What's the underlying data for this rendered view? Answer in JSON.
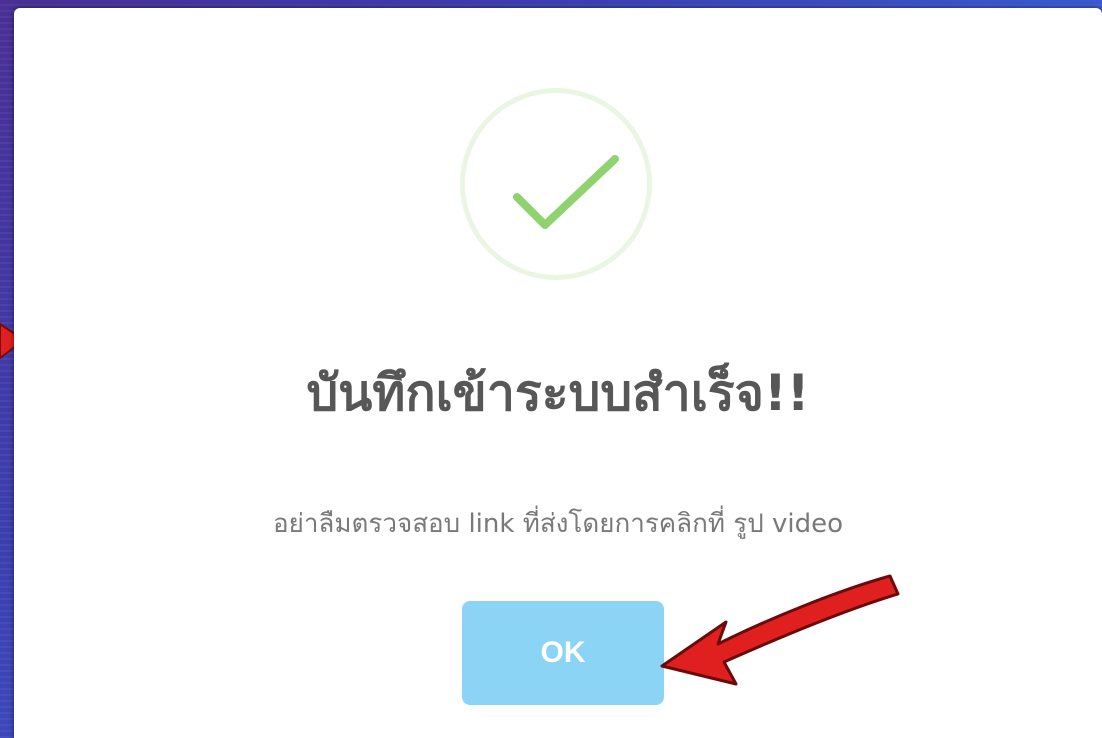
{
  "dialog": {
    "title": "บันทึกเข้าระบบสำเร็จ!!",
    "message": "อย่าลืมตรวจสอบ link ที่ส่งโดยการคลิกที่ รูป video",
    "ok_label": "OK"
  },
  "icons": {
    "success": "checkmark-icon",
    "annotation": "red-arrow-icon"
  },
  "colors": {
    "checkmark": "#8fd36e",
    "circle_border": "#eaf6e3",
    "ok_button": "#8cd4f5",
    "title_text": "#575757",
    "message_text": "#797979",
    "annotation_arrow": "#e0201f"
  }
}
